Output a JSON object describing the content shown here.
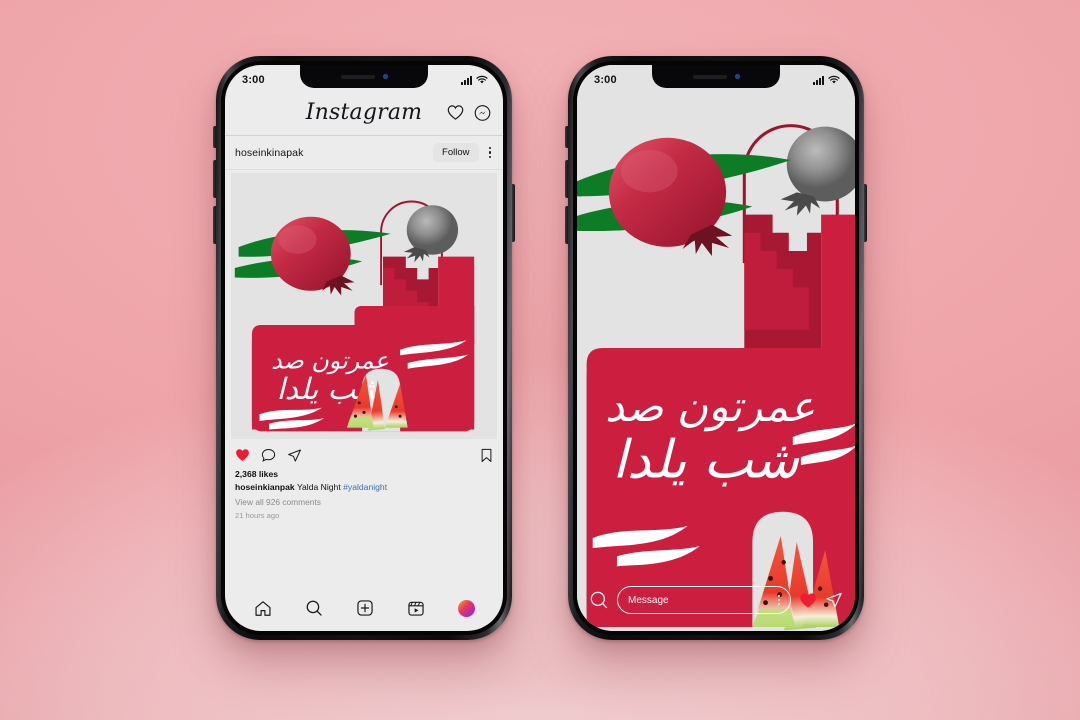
{
  "scene": {
    "background_top_color": "#EFA5AA",
    "background_bottom_color": "#F4D2D4",
    "device_count": 2
  },
  "status_bar": {
    "time": "3:00",
    "signal_icon": "cellular-bars-icon",
    "wifi_icon": "wifi-icon"
  },
  "phone_feed": {
    "app_header": {
      "logo_text": "Instagram",
      "heart_icon": "heart-outline-icon",
      "messenger_icon": "messenger-icon"
    },
    "post": {
      "username": "hoseinkinapak",
      "follow_label": "Follow",
      "more_icon": "more-options-icon",
      "actions": {
        "like_icon": "heart-filled-icon",
        "comment_icon": "comment-bubble-icon",
        "share_icon": "share-paperplane-icon",
        "save_icon": "bookmark-icon",
        "like_color": "#ED1B34"
      },
      "likes": "2,368 likes",
      "caption_author": "hoseinkianpak",
      "caption_text": "Yalda Night",
      "caption_hashtag": "#yaldanight",
      "comments_link": "View all 926 comments",
      "timestamp": "21 hours ago"
    },
    "tab_bar": {
      "items": [
        {
          "name": "home-icon",
          "label": "Home"
        },
        {
          "name": "search-icon",
          "label": "Search"
        },
        {
          "name": "add-post-icon",
          "label": "Create"
        },
        {
          "name": "reels-icon",
          "label": "Reels"
        },
        {
          "name": "profile-avatar",
          "label": "Profile"
        }
      ]
    }
  },
  "phone_story": {
    "bottom_bar": {
      "camera_icon": "camera-search-icon",
      "message_placeholder": "Message",
      "message_value": "",
      "more_icon": "message-more-icon",
      "heart_icon": "heart-filled-icon",
      "send_icon": "share-paperplane-icon",
      "heart_color": "#ED1B34"
    }
  },
  "artwork": {
    "title_line1": "عمرتون صد",
    "title_line2": "شب یلدا",
    "translit": "Omretoon sad shab-e Yalda",
    "theme": "Yalda Night greeting",
    "colors": {
      "crimson": "#CC1F40",
      "crimson_dark": "#A81833",
      "canvas": "#E3E3E3",
      "leaf_green": "#0E7B27",
      "pomegranate_red": "#C0293E",
      "watermelon_red": "#E8412F",
      "watermelon_rind": "#BBDE7C",
      "arch_outline": "#9E142B"
    },
    "elements": [
      "pomegranate-red",
      "pomegranate-grayscale",
      "leaf-strokes",
      "stepped-ziggurat-shape",
      "arch-outline",
      "calligraphy",
      "wave-strokes",
      "watermelon-slices"
    ]
  }
}
